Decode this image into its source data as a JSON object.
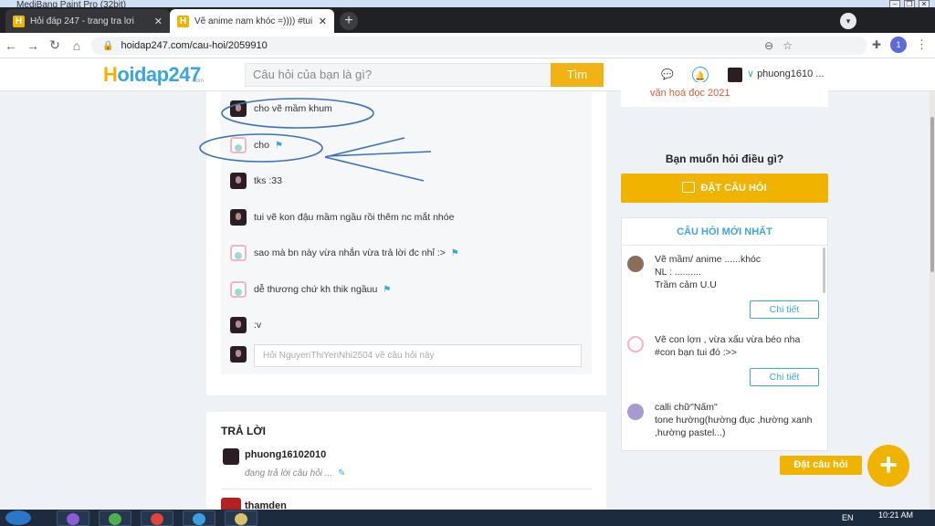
{
  "window": {
    "title": "MediBang Paint Pro (32bit)"
  },
  "browser": {
    "tabs": [
      {
        "label": "Hỏi đáp 247 - trang tra lơi",
        "active": false
      },
      {
        "label": "Vẽ anime nam khóc =)))) #tui có",
        "active": true
      }
    ],
    "url": "hoidap247.com/cau-hoi/2059910",
    "profile_initial": "1"
  },
  "header": {
    "logo_main": "oidap247",
    "logo_h": "H",
    "logo_sub": ".com",
    "search_placeholder": "Câu hỏi của bạn là gì?",
    "search_button": "Tìm",
    "username": "phuong1610 ..."
  },
  "comments": [
    {
      "text": "cho vẽ mầm khum",
      "avatar": "dark",
      "flag": false
    },
    {
      "text": "cho",
      "avatar": "pink",
      "flag": true
    },
    {
      "text": "tks :33",
      "avatar": "dark",
      "flag": false
    },
    {
      "text": "tui vẽ kon đậu mầm ngầu rồi thêm nc mắt nhóe",
      "avatar": "dark",
      "flag": false
    },
    {
      "text": "sao mà bn này vừa nhắn vừa trả lời đc nhỉ :>",
      "avatar": "pink",
      "flag": true
    },
    {
      "text": "dễ thương chứ kh thik ngầuu",
      "avatar": "pink",
      "flag": true
    },
    {
      "text": ":v",
      "avatar": "dark",
      "flag": false
    }
  ],
  "reply_placeholder": "Hỏi NguyenThiYenNhi2504 về câu hỏi này",
  "answers": {
    "title": "TRẢ LỜI",
    "user1": "phuong16102010",
    "status": "đang trả lời câu hỏi ...",
    "user2": "thamden"
  },
  "sidebar": {
    "top_text": "văn hoá đọc 2021",
    "ask_title": "Bạn muốn hỏi điều gì?",
    "ask_button": "ĐẶT CÂU HỎI",
    "new_title": "CÂU HỎI MỚI NHẤT",
    "questions": [
      {
        "text": "Vẽ mầm/ anime ......khóc\nNL : ..........\nTrầm cảm U.U",
        "button": "Chi tiết"
      },
      {
        "text": "Vẽ con lợn , vừa xấu vừa béo nha\n#con bạn tui đó :>>",
        "button": "Chi tiết"
      },
      {
        "text": "calli chữ\"Nấm\"\ntone hường(hường đục ,hường xanh ,hường pastel...)",
        "button": ""
      }
    ]
  },
  "fab": {
    "label": "Đặt câu hỏi",
    "icon": "+"
  },
  "taskbar": {
    "lang": "EN",
    "time": "10:21 AM"
  },
  "colors": {
    "accent": "#f0b400",
    "link": "#3aa6e0",
    "annotation": "#3b72b8"
  }
}
